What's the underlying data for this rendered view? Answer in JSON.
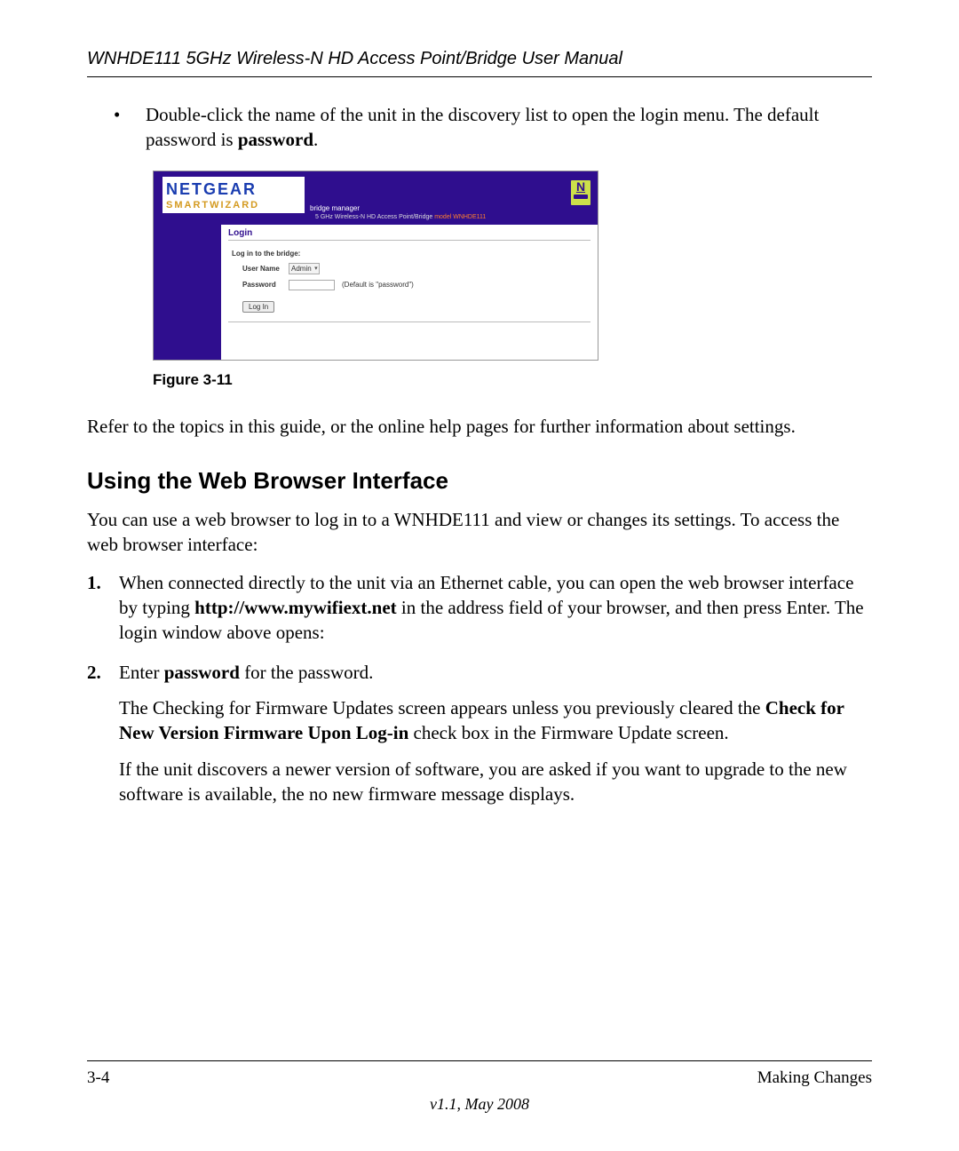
{
  "header": {
    "title": "WNHDE111 5GHz Wireless-N HD Access Point/Bridge User Manual"
  },
  "bullet": {
    "dot": "•",
    "text_pre": "Double-click the name of the unit in the discovery list to open the login menu. The default password is ",
    "text_bold": "password",
    "text_post": "."
  },
  "screenshot": {
    "logo": "NETGEAR",
    "smartwizard": "SMARTWIZARD",
    "sub_line1": "bridge manager",
    "sub_line2_a": "5 GHz Wireless-N HD Access Point/Bridge ",
    "sub_line2_model": "model WNHDE111",
    "badge_letter": "N",
    "login_title": "Login",
    "prompt": "Log in to the bridge:",
    "username_label": "User Name",
    "username_value": "Admin",
    "password_label": "Password",
    "password_hint": "(Default is \"password\")",
    "login_button": "Log In"
  },
  "figure_caption": "Figure 3-11",
  "para_refer": "Refer to the topics in this guide, or the online help pages for further information about settings.",
  "section_heading": "Using the Web Browser Interface",
  "para_intro": "You can use a web browser to log in to a WNHDE111 and view or changes its settings. To access the web browser interface:",
  "step1": {
    "pre": "When connected directly to the unit via an Ethernet cable, you can open the web browser interface by typing ",
    "bold": "http://www.mywifiext.net",
    "post": " in the address field of your browser, and then press Enter. The login window above opens:"
  },
  "step2": {
    "pre": "Enter ",
    "bold": "password",
    "post": " for the password.",
    "para2_pre": "The Checking for Firmware Updates screen appears unless you previously cleared the ",
    "para2_bold": "Check for New Version Firmware Upon Log-in",
    "para2_post": " check box in the Firmware Update screen.",
    "para3": "If the unit discovers a newer version of software, you are asked if you want to upgrade to the new software is available, the no new firmware message displays."
  },
  "footer": {
    "page": "3-4",
    "section": "Making Changes",
    "version": "v1.1, May 2008"
  }
}
